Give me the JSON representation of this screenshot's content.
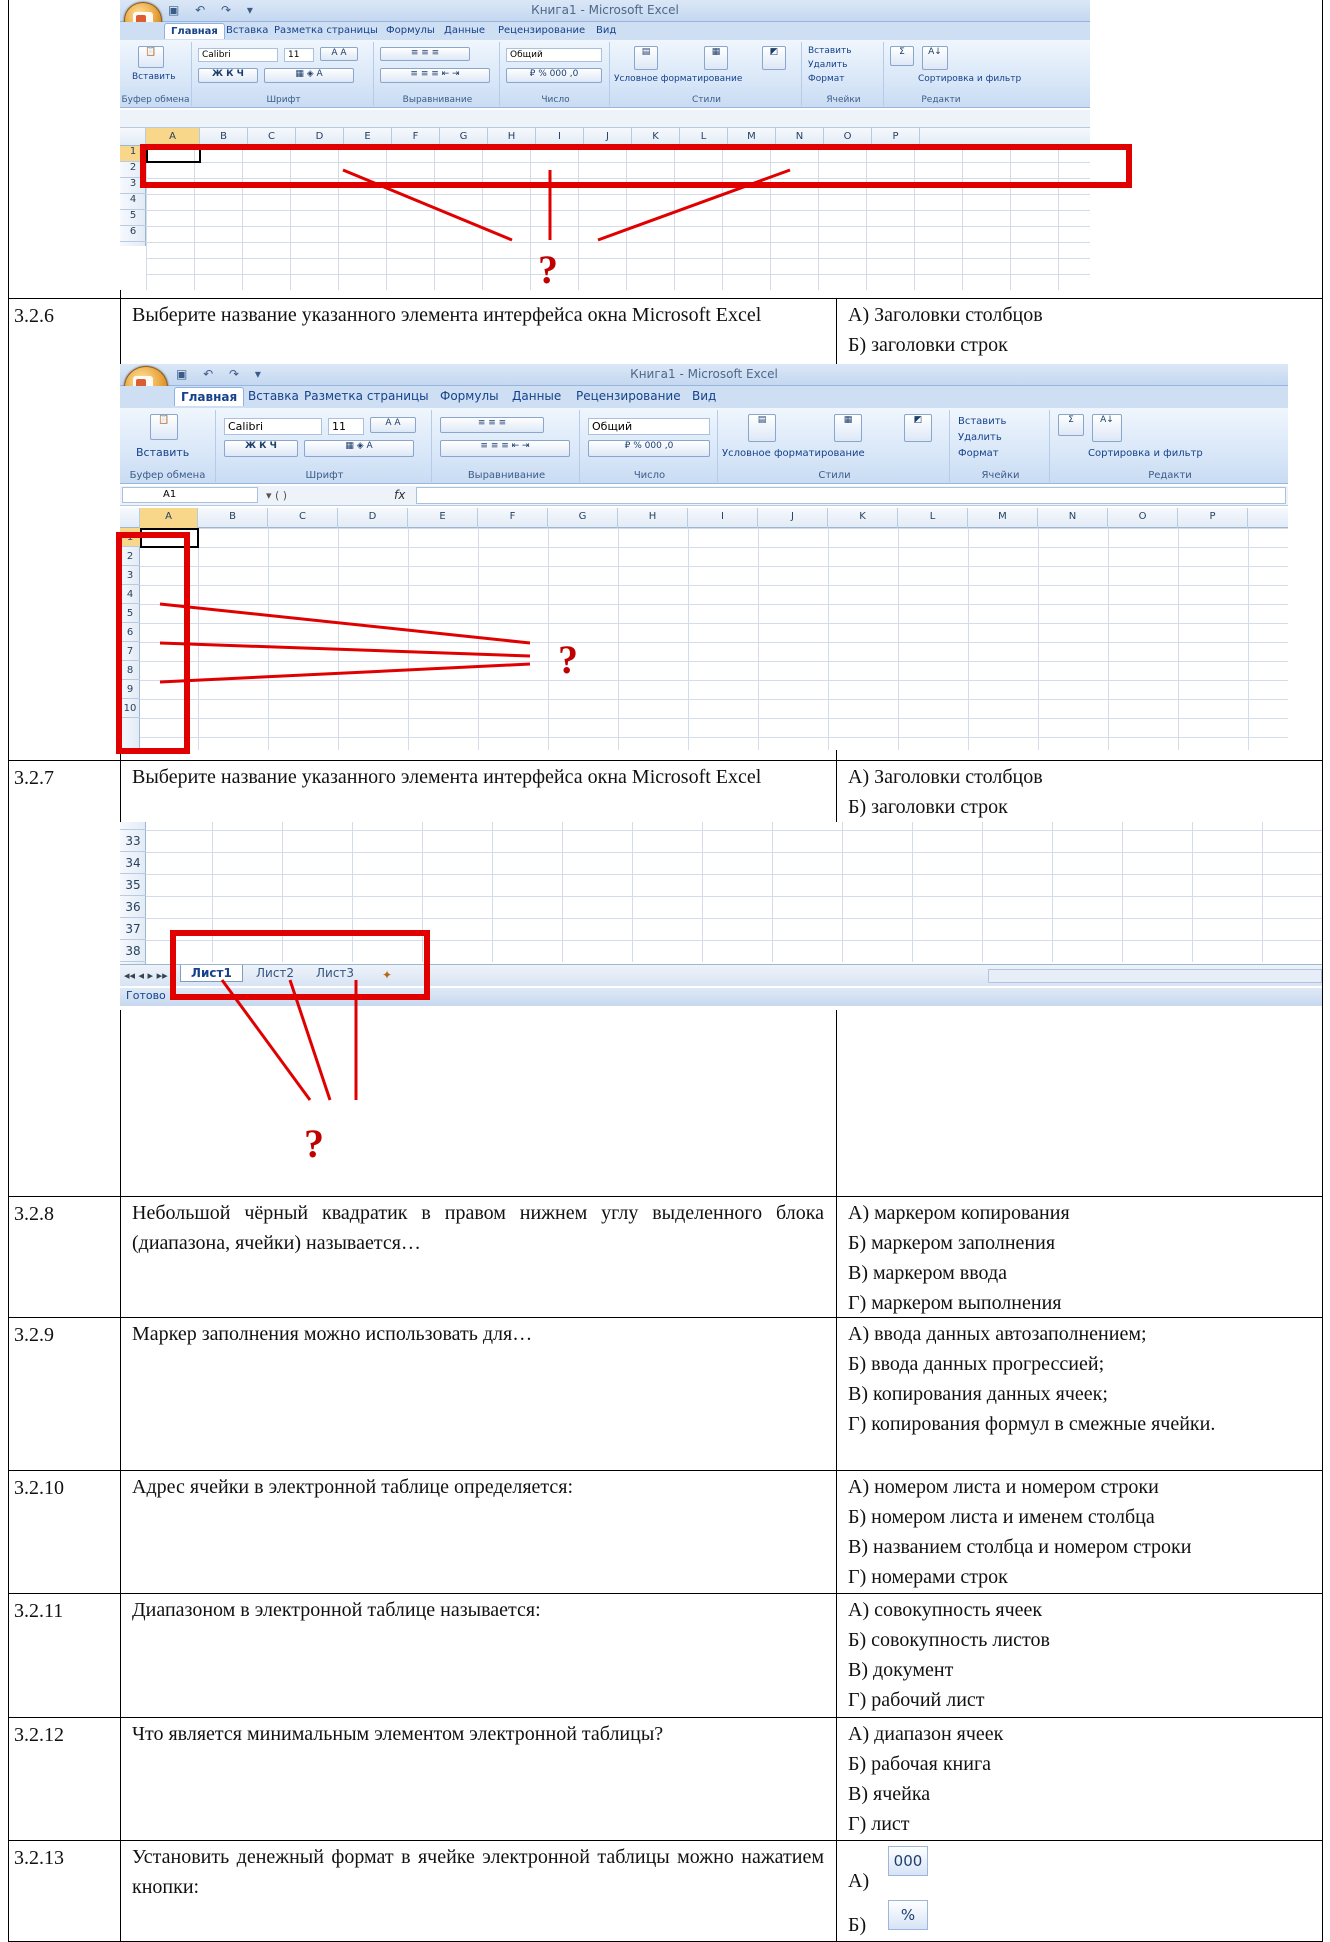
{
  "excel": {
    "title": "Книга1 - Microsoft Excel",
    "tabs": [
      "Главная",
      "Вставка",
      "Разметка страницы",
      "Формулы",
      "Данные",
      "Рецензирование",
      "Вид"
    ],
    "paste_label": "Вставить",
    "font_name": "Calibri",
    "font_size": "11",
    "number_format": "Общий",
    "group_labels": [
      "Буфер обмена",
      "Шрифт",
      "Выравнивание",
      "Число",
      "Стили",
      "Ячейки",
      "Редакти"
    ],
    "styles_items": [
      "Условное форматирование",
      "Форматировать как таблицу",
      "Стили ячеек"
    ],
    "cells_items": [
      "Вставить",
      "Удалить",
      "Формат"
    ],
    "editing_items": [
      "Сортировка и фильтр"
    ],
    "name_box": "A1",
    "columns": [
      "A",
      "B",
      "C",
      "D",
      "E",
      "F",
      "G",
      "H",
      "I",
      "J",
      "K",
      "L",
      "M",
      "N",
      "O",
      "P"
    ],
    "rows1": [
      "1",
      "2",
      "3",
      "4",
      "5",
      "6"
    ],
    "rows2": [
      "1",
      "2",
      "3",
      "4",
      "5",
      "6",
      "7",
      "8",
      "9",
      "10"
    ],
    "rows3": [
      "33",
      "34",
      "35",
      "36",
      "37",
      "38"
    ],
    "sheet_tabs": [
      "Лист1",
      "Лист2",
      "Лист3"
    ],
    "status": "Готово",
    "question_mark": "?"
  },
  "rows": [
    {
      "num": "3.2.6",
      "question": "Выберите название указанного элемента интерфейса окна Microsoft Excel",
      "answers": [
        "А) Заголовки столбцов",
        "Б) заголовки строк"
      ]
    },
    {
      "num": "3.2.7",
      "question": "Выберите название указанного элемента интерфейса окна Microsoft Excel",
      "answers": [
        "А) Заголовки столбцов",
        "Б) заголовки строк"
      ]
    },
    {
      "num": "3.2.8",
      "question": "Небольшой чёрный квадратик в правом нижнем углу выделенного блока (диапазона, ячейки) называется…",
      "answers": [
        "А) маркером копирования",
        "Б) маркером заполнения",
        "В) маркером ввода",
        "Г) маркером выполнения"
      ]
    },
    {
      "num": "3.2.9",
      "question": "Маркер заполнения можно использовать для…",
      "answers": [
        "А) ввода данных автозаполнением;",
        "Б) ввода данных прогрессией;",
        "В) копирования данных ячеек;",
        "Г) копирования формул в смежные ячейки."
      ]
    },
    {
      "num": "3.2.10",
      "question": "Адрес ячейки в электронной таблице определяется:",
      "answers": [
        "А) номером листа и номером строки",
        "Б) номером листа и именем столбца",
        "В) названием столбца и номером строки",
        "Г) номерами строк"
      ]
    },
    {
      "num": "3.2.11",
      "question": "Диапазоном в электронной таблице называется:",
      "answers": [
        "А) совокупность ячеек",
        "Б) совокупность листов",
        "В) документ",
        "Г) рабочий лист"
      ]
    },
    {
      "num": "3.2.12",
      "question": "Что является минимальным элементом электронной таблицы?",
      "answers": [
        "А) диапазон ячеек",
        "Б) рабочая книга",
        "В) ячейка",
        "Г) лист"
      ]
    },
    {
      "num": "3.2.13",
      "question": "Установить денежный формат в ячейке электронной таблицы можно нажатием кнопки:",
      "answers": [
        "А)",
        "Б)"
      ],
      "buttons": [
        "000",
        "%"
      ]
    }
  ]
}
